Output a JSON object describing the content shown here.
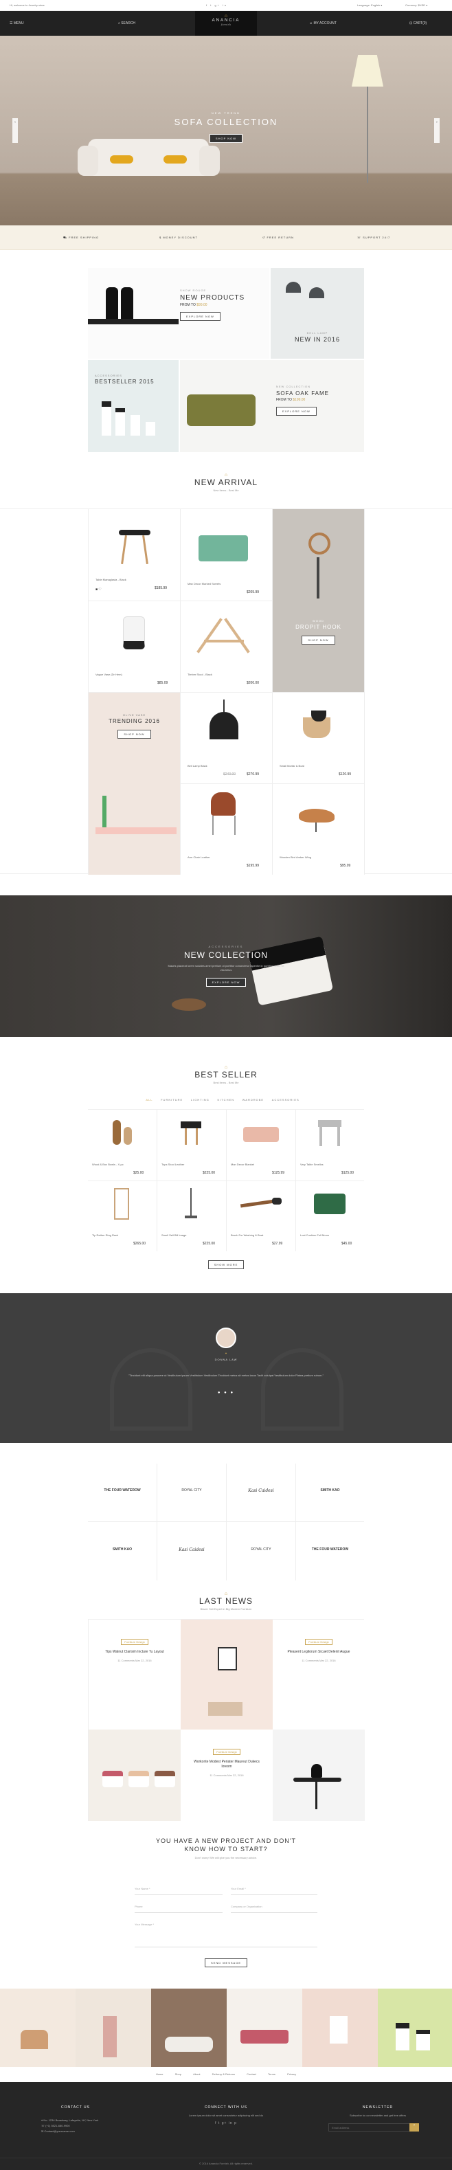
{
  "topbar": {
    "email": "Hi, welcome to Jewelry store",
    "phone": "",
    "social": "f  t  g+  in",
    "language": "Language: English ▾",
    "currency": "Currency: $USD ▾"
  },
  "nav": {
    "menu": "MENU",
    "search": "SEARCH",
    "logo": "ANANCIA",
    "logo_sub": "furnish",
    "account": "MY ACCOUNT",
    "cart": "CART(0)"
  },
  "hero": {
    "kicker": "NEW TREND",
    "title": "SOFA COLLECTION",
    "button": "SHOP NOW"
  },
  "features": [
    "FREE SHIPPING",
    "MONEY DISCOUNT",
    "FREE RETURN",
    "SUPPORT 24/7"
  ],
  "promo": {
    "p1": {
      "kicker": "SHOW ROUGE",
      "title_line1": "NEW PRODUCTS",
      "title_line2": "FROM TO",
      "accent": "$99.00",
      "button": "EXPLORE NOW"
    },
    "p2": {
      "kicker": "BELL LAMP",
      "title": "NEW IN 2016"
    },
    "p3": {
      "kicker": "ACCESSORIES",
      "title": "BESTSELLER 2015"
    },
    "p4": {
      "kicker": "NEW COLLECTION",
      "title_line1": "SOFA OAK FAME",
      "title_line2": "FROM TO",
      "accent": "$199.00",
      "button": "EXPLORE NOW"
    }
  },
  "new_arrival": {
    "title": "NEW ARRIVAL",
    "subtitle": "New Items - Best Me",
    "products": [
      {
        "name": "Table Managlasta - Black",
        "price": "$185.99"
      },
      {
        "name": "Man Decor Marked Sweets",
        "price": "$205.99"
      },
      {
        "name": "Vague Vase (Dr Hem)",
        "price": "$85.09"
      },
      {
        "name": "Timber Stool - Black",
        "price": "$200.00"
      },
      {
        "name": "Bell Lamp Black",
        "old": "$240.00",
        "price": "$270.99"
      },
      {
        "name": "Small Mortar & Boat",
        "price": "$120.99"
      },
      {
        "name": "Arm Chair Leather",
        "price": "$195.99"
      },
      {
        "name": "Wooden Bird Amber Wing",
        "price": "$95.09"
      }
    ],
    "dropit": {
      "kicker": "WOOD",
      "title": "DROPIT HOOK",
      "button": "SHOP NOW"
    },
    "trending": {
      "kicker": "OLIVE VASE",
      "title": "TRENDING 2016",
      "button": "SHOP NOW"
    }
  },
  "banner": {
    "kicker": "ACCESSORIES",
    "title": "NEW COLLECTION",
    "text": "Mauris placerat lorem sodales amet pretium ut porttitor consectetur lapentie in porttitor lorem sit vita tellus",
    "button": "EXPLORE NOW"
  },
  "best_seller": {
    "title": "BEST SELLER",
    "subtitle": "Best items - Best Me",
    "tabs": [
      "ALL",
      "FURNITURE",
      "LIGHTING",
      "KITCHEN",
      "WARDROBE",
      "ACCESSORIES"
    ],
    "products": [
      {
        "name": "Wood & Box Bowls - X-pc",
        "price": "$25.00"
      },
      {
        "name": "Tops Stool Leather",
        "price": "$225.00"
      },
      {
        "name": "Man Decor Blanket",
        "price": "$125.99"
      },
      {
        "name": "Vary Table Smellzs",
        "price": "$125.00"
      },
      {
        "name": "Tip Rather Ring Rack",
        "price": "$265.00"
      },
      {
        "name": "Smell Sell Bill Image",
        "price": "$225.00"
      },
      {
        "name": "Brush For Washing & Boat",
        "price": "$27.99"
      },
      {
        "name": "Lost Cushion Full Moon",
        "price": "$45.00"
      }
    ],
    "button": "SHOW MORE"
  },
  "testimonial": {
    "name": "DONNA LAW",
    "text": "\"Tincidunt elit aliqua posuere ut Vestibulum ipsum Vestibulum Vestibulum Tincidunt metus sit metus lacus Taciti volutpat Vestibulum dolor Platea pretium rutrum.\""
  },
  "brands": [
    "THE FOUR WATEROW",
    "ROYAL CITY",
    "Kasi Caidesi",
    "SMITH KAO",
    "SMITH KAO",
    "Kasi Caidesi",
    "ROYAL CITY",
    "THE FOUR WATEROW"
  ],
  "news": {
    "title": "LAST NEWS",
    "subtitle": "Blazer Sell Expert in Big Modern Furniture",
    "posts": [
      {
        "tag": "Furniture Design",
        "title": "Tips Walnut Clarisim Incture Tu Layout",
        "meta": "11 Comments    Mar 22, 2016"
      },
      {
        "tag": "Furniture Design",
        "title": "Pleasent Legitorum Sicuet Delenit Augue",
        "meta": "11 Comments    Mar 22, 2016"
      },
      {
        "tag": "Furniture Design",
        "title": "Workonte Modest Periater Maureut Dukecs loresm",
        "meta": "11 Comments    Mar 22, 2016"
      }
    ]
  },
  "contact": {
    "title_line1": "YOU HAVE A NEW PROJECT AND DON'T",
    "title_line2": "KNOW HOW TO START?",
    "subtitle": "Don't worry! We will give you the necessary advice.",
    "name": "Your Name *",
    "email": "Your Email *",
    "phone": "Phone",
    "company": "Company or Organization",
    "message": "Your Message *",
    "button": "SEND MESSAGE"
  },
  "footer_links": [
    "Home",
    "Shop",
    "About",
    "Delivery & Returns",
    "Contact",
    "Terms",
    "Privacy"
  ],
  "footer": {
    "contact_title": "CONTACT US",
    "address": "No. 1234 Broadway, Lafayette, NY, New York",
    "phone": "(+1) 5521-680-9900",
    "mail": "Contact@yourname.com",
    "connect_title": "CONNECT WITH US",
    "connect_text": "Lorem ipsum dolor sit amet consectetur adipiscing elit sed do",
    "social": "f   t   g+   in   p",
    "news_title": "NEWSLETTER",
    "news_text": "Subscribe to our newsletter and get free offers",
    "news_placeholder": "Email address",
    "copyright": "© 2016 Anancia Furnish. All rights reserved."
  },
  "colors": {
    "accent": "#c9a552",
    "dark": "#262626"
  }
}
